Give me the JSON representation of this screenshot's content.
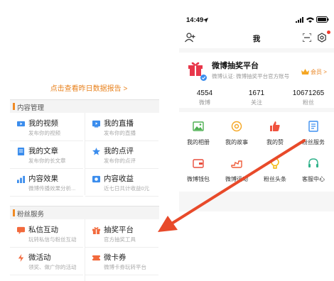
{
  "left": {
    "report_link": "点击查看昨日数据报告 >",
    "sections": [
      {
        "title": "内容管理",
        "items": [
          {
            "title": "我的视频",
            "sub": "发布你的视频",
            "icon": "video-icon"
          },
          {
            "title": "我的直播",
            "sub": "发布你的直播",
            "icon": "live-icon"
          },
          {
            "title": "我的文章",
            "sub": "发布你的长文章",
            "icon": "article-icon"
          },
          {
            "title": "我的点评",
            "sub": "发布你的点评",
            "icon": "review-icon"
          },
          {
            "title": "内容效果",
            "sub": "微博传播效果分析...",
            "icon": "chart-icon"
          },
          {
            "title": "内容收益",
            "sub": "近七日共计收益0元",
            "icon": "income-icon"
          }
        ]
      },
      {
        "title": "粉丝服务",
        "items": [
          {
            "title": "私信互动",
            "sub": "玩转私信与粉丝互动",
            "icon": "message-icon"
          },
          {
            "title": "抽奖平台",
            "sub": "官方抽奖工具",
            "icon": "gift-icon"
          },
          {
            "title": "微活动",
            "sub": "领奖、做广你的活动",
            "icon": "activity-icon"
          },
          {
            "title": "微卡券",
            "sub": "微博卡券玩转平台",
            "icon": "coupon-icon"
          }
        ]
      }
    ]
  },
  "phone": {
    "time": "14:49",
    "nav_title": "我",
    "profile": {
      "name": "微博抽奖平台",
      "desc": "微博认证: 微博抽奖平台官方账号",
      "badge": "会员 >"
    },
    "stats": [
      {
        "num": "4554",
        "label": "微博"
      },
      {
        "num": "1671",
        "label": "关注"
      },
      {
        "num": "10671265",
        "label": "粉丝"
      }
    ],
    "grid": [
      {
        "label": "我的相册",
        "icon": "album-icon",
        "color": "#4caf50"
      },
      {
        "label": "我的故事",
        "icon": "story-icon",
        "color": "#f5a623"
      },
      {
        "label": "我的赞",
        "icon": "like-icon",
        "color": "#f0523e"
      },
      {
        "label": "粉丝服务",
        "icon": "fans-service-icon",
        "color": "#3d8ff0"
      },
      {
        "label": "微博钱包",
        "icon": "wallet-icon",
        "color": "#e94d3c"
      },
      {
        "label": "微博运动",
        "icon": "sport-icon",
        "color": "#ef5b38"
      },
      {
        "label": "粉丝头条",
        "icon": "headline-icon",
        "color": "#f4b400"
      },
      {
        "label": "客服中心",
        "icon": "service-icon",
        "color": "#2fb28a"
      }
    ]
  },
  "colors": {
    "accent": "#f08a24",
    "arrow": "#e84a2a"
  }
}
